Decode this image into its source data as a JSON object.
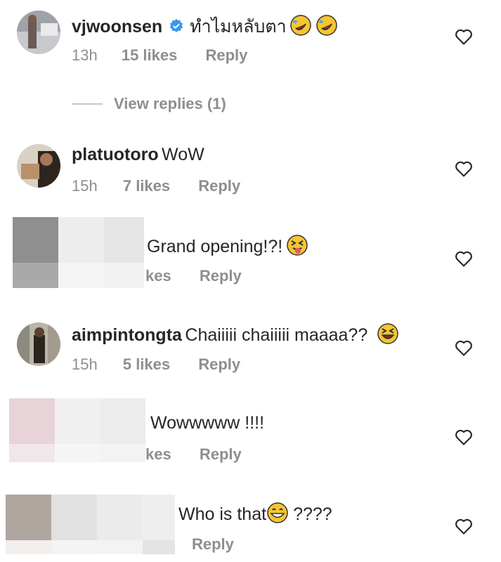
{
  "comments": [
    {
      "username": "vjwoonsen",
      "text": "ทำไมหลับตา",
      "time": "13h",
      "likes": "15 likes",
      "reply": "Reply",
      "verified": true
    },
    {
      "username": "platuotoro",
      "text": "WoW",
      "time": "15h",
      "likes": "7 likes",
      "reply": "Reply"
    },
    {
      "username": "",
      "text": "Grand opening!?!",
      "partial_meta": "kes",
      "reply": "Reply"
    },
    {
      "username": "aimpintongta",
      "text": "Chaiiiii chaiiiii maaaa??",
      "time": "15h",
      "likes": "5 likes",
      "reply": "Reply"
    },
    {
      "username": "",
      "text": "Wowwwww !!!!",
      "partial_meta": "kes",
      "reply": "Reply"
    },
    {
      "username": "",
      "text": "Who is that",
      "text_after": "????",
      "reply": "Reply"
    }
  ],
  "view_replies": "View replies (1)",
  "icons": {
    "heart": "heart-outline-icon",
    "verified": "verified-badge-icon"
  },
  "colors": {
    "text": "#262626",
    "meta": "#8e8e8e",
    "verified": "#3897f0"
  }
}
